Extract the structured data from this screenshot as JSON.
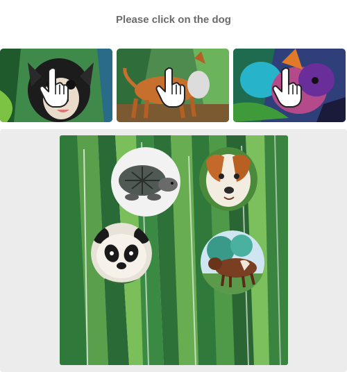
{
  "instruction": "Please click on the dog",
  "examples": [
    {
      "name": "dog-example-1",
      "icon": "pointer-hand-icon"
    },
    {
      "name": "dog-example-2",
      "icon": "pointer-hand-icon"
    },
    {
      "name": "dog-example-3",
      "icon": "pointer-hand-icon"
    }
  ],
  "scene_animals": [
    "turtle",
    "dog",
    "panda",
    "cow"
  ],
  "colors": {
    "panel_bg": "#ececec",
    "title": "#6b6b6b",
    "grass": "#2f7a3a"
  }
}
